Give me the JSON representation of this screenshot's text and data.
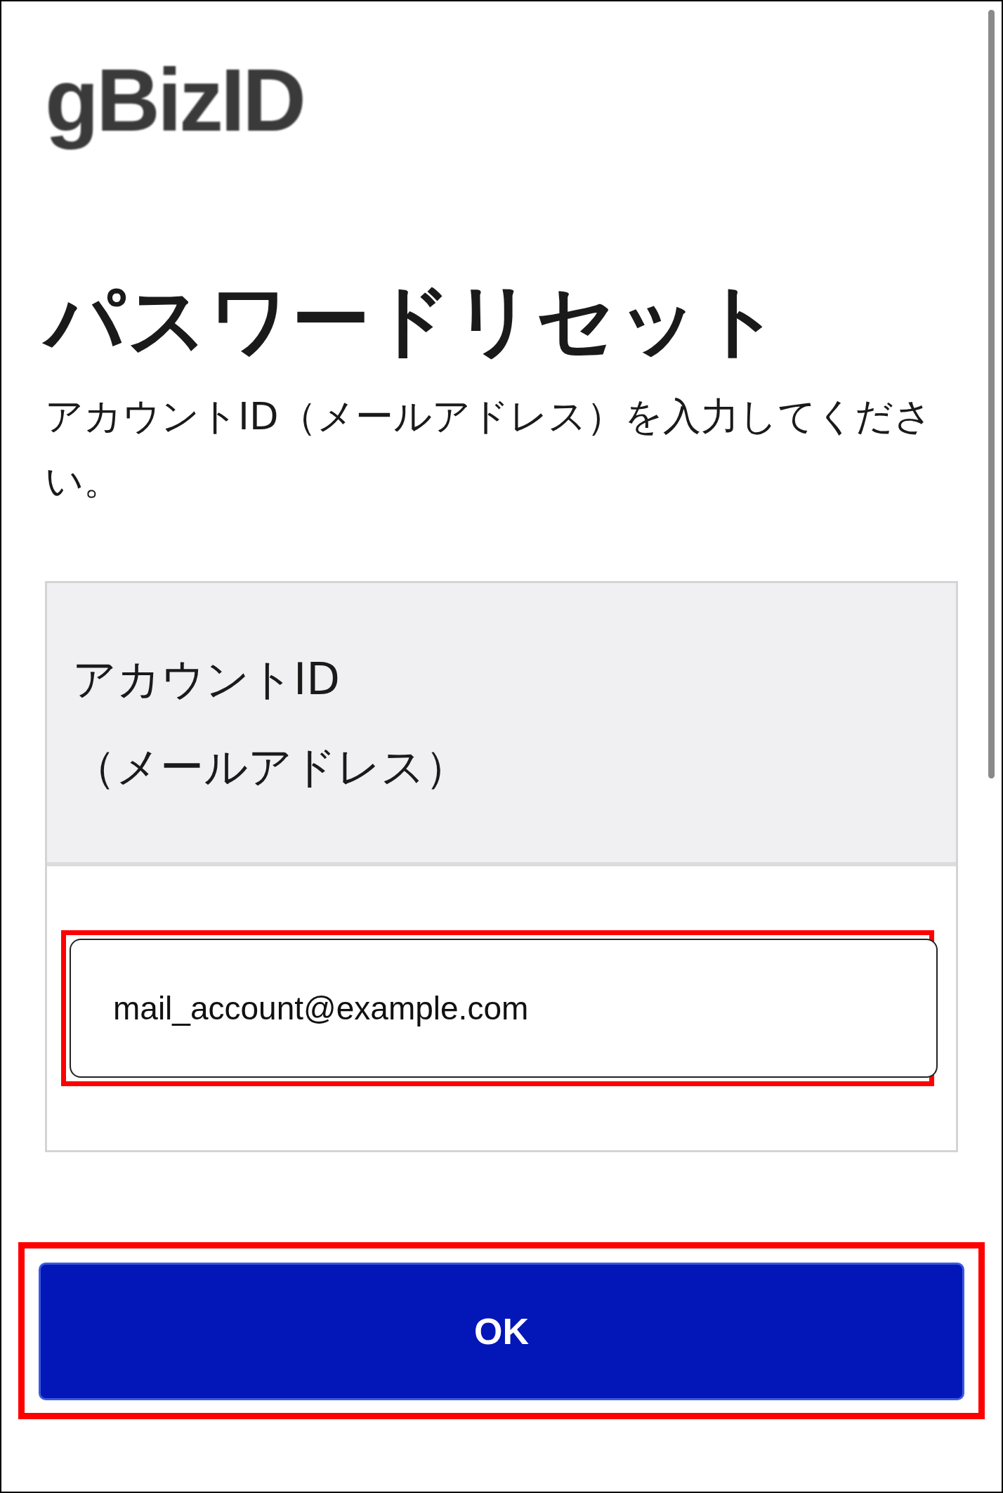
{
  "logo": {
    "text": "gBizID"
  },
  "title": "パスワードリセット",
  "description": "アカウントID（メールアドレス）を入力してください。",
  "form": {
    "label": "アカウントID\n（メールアドレス）",
    "value": "mail_account@example.com",
    "highlighted": true
  },
  "submit": {
    "label": "OK",
    "highlighted": true
  }
}
